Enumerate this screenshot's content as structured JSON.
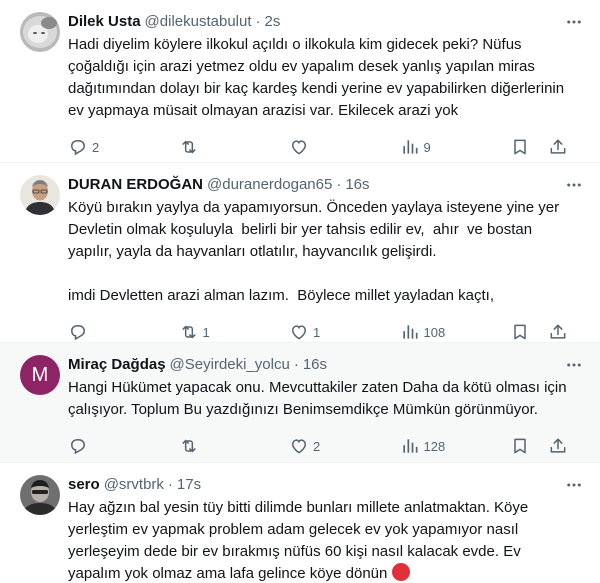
{
  "tweets": [
    {
      "name": "Dilek Usta",
      "handle": "@dilekustabulut",
      "time": "2s",
      "text": "Hadi diyelim köylere ilkokul açıldı o ilkokula kim gidecek peki? Nüfus çoğaldığı için arazi yetmez oldu ev yapalım desek yanlış yapılan miras dağıtımından dolayı bir kaç kardeş kendi yerine ev yapabilirken diğerlerinin ev yapmaya müsait olmayan arazisi var. Ekilecek arazi yok",
      "replies": "2",
      "retweets": "",
      "likes": "",
      "views": "9"
    },
    {
      "name": "DURAN ERDOĞAN",
      "handle": "@duranerdogan65",
      "time": "16s",
      "text": "Köyü bırakın yaylya da yapamıyorsun. Önceden yaylaya isteyene yine yer Devletin olmak koşuluyla  belirli bir yer tahsis edilir ev,  ahır  ve bostan yapılır, yayla da hayvanları otlatılır, hayvancılık gelişirdi.\n\nimdi Devletten arazi alman lazım.  Böylece millet yayladan kaçtı,",
      "replies": "",
      "retweets": "1",
      "likes": "1",
      "views": "108"
    },
    {
      "name": "Miraç Dağdaş",
      "handle": "@Seyirdeki_yolcu",
      "time": "16s",
      "avatar_letter": "M",
      "text": "Hangi Hükümet yapacak onu. Mevcuttakiler zaten Daha da kötü olması için çalışıyor. Toplum Bu yazdığınızı Benimsemdikçe Mümkün görünmüyor.",
      "replies": "",
      "retweets": "",
      "likes": "2",
      "views": "128"
    },
    {
      "name": "sero",
      "handle": "@srvtbrk",
      "time": "17s",
      "text": "Hay ağzın bal yesin tüy bitti dilimde bunları millete anlatmaktan. Köye yerleştim ev yapmak problem adam gelecek ev yok yapamıyor nasıl yerleşeyim dede bir ev bırakmış nüfüs 60 kişi nasıl kalacak evde. Ev yapalım yok olmaz ama lafa gelince köye dönün",
      "emoji": "😡"
    }
  ],
  "icons": {
    "reply": "reply-icon",
    "retweet": "retweet-icon",
    "like": "like-icon",
    "views": "views-icon",
    "bookmark": "bookmark-icon",
    "share": "share-icon",
    "more": "more-icon"
  },
  "colors": {
    "text": "#0f1419",
    "secondary": "#536471",
    "divider": "#eff3f4",
    "highlight_bg": "#f7f9f9",
    "avatar_purple": "#8e2466",
    "angry_emoji": "#e0303a"
  }
}
